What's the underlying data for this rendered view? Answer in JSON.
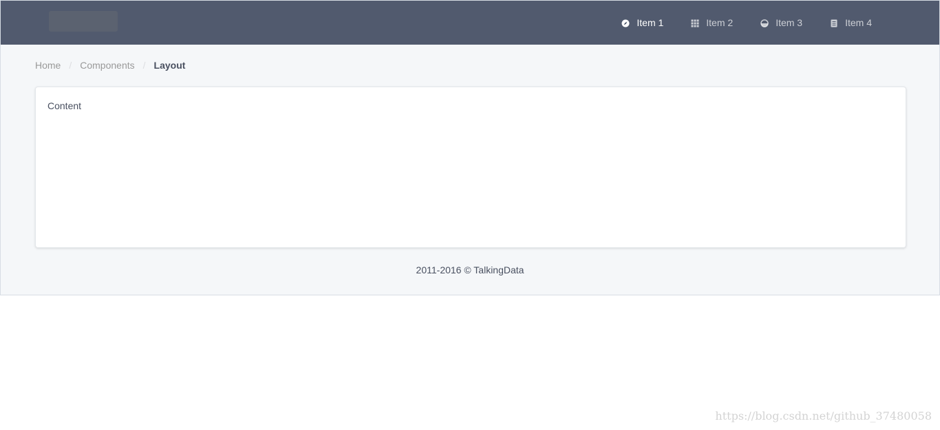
{
  "header": {
    "menu": [
      {
        "label": "Item 1",
        "icon": "compass-icon",
        "active": true
      },
      {
        "label": "Item 2",
        "icon": "grid-icon",
        "active": false
      },
      {
        "label": "Item 3",
        "icon": "pie-chart-icon",
        "active": false
      },
      {
        "label": "Item 4",
        "icon": "document-icon",
        "active": false
      }
    ]
  },
  "breadcrumb": {
    "items": [
      "Home",
      "Components",
      "Layout"
    ],
    "separator": "/"
  },
  "content": {
    "text": "Content"
  },
  "footer": {
    "text": "2011-2016 © TalkingData"
  },
  "watermark": {
    "text": "https://blog.csdn.net/github_37480058"
  },
  "colors": {
    "header_bg": "#515a6e",
    "page_bg": "#f5f7f9",
    "text": "#495060"
  }
}
